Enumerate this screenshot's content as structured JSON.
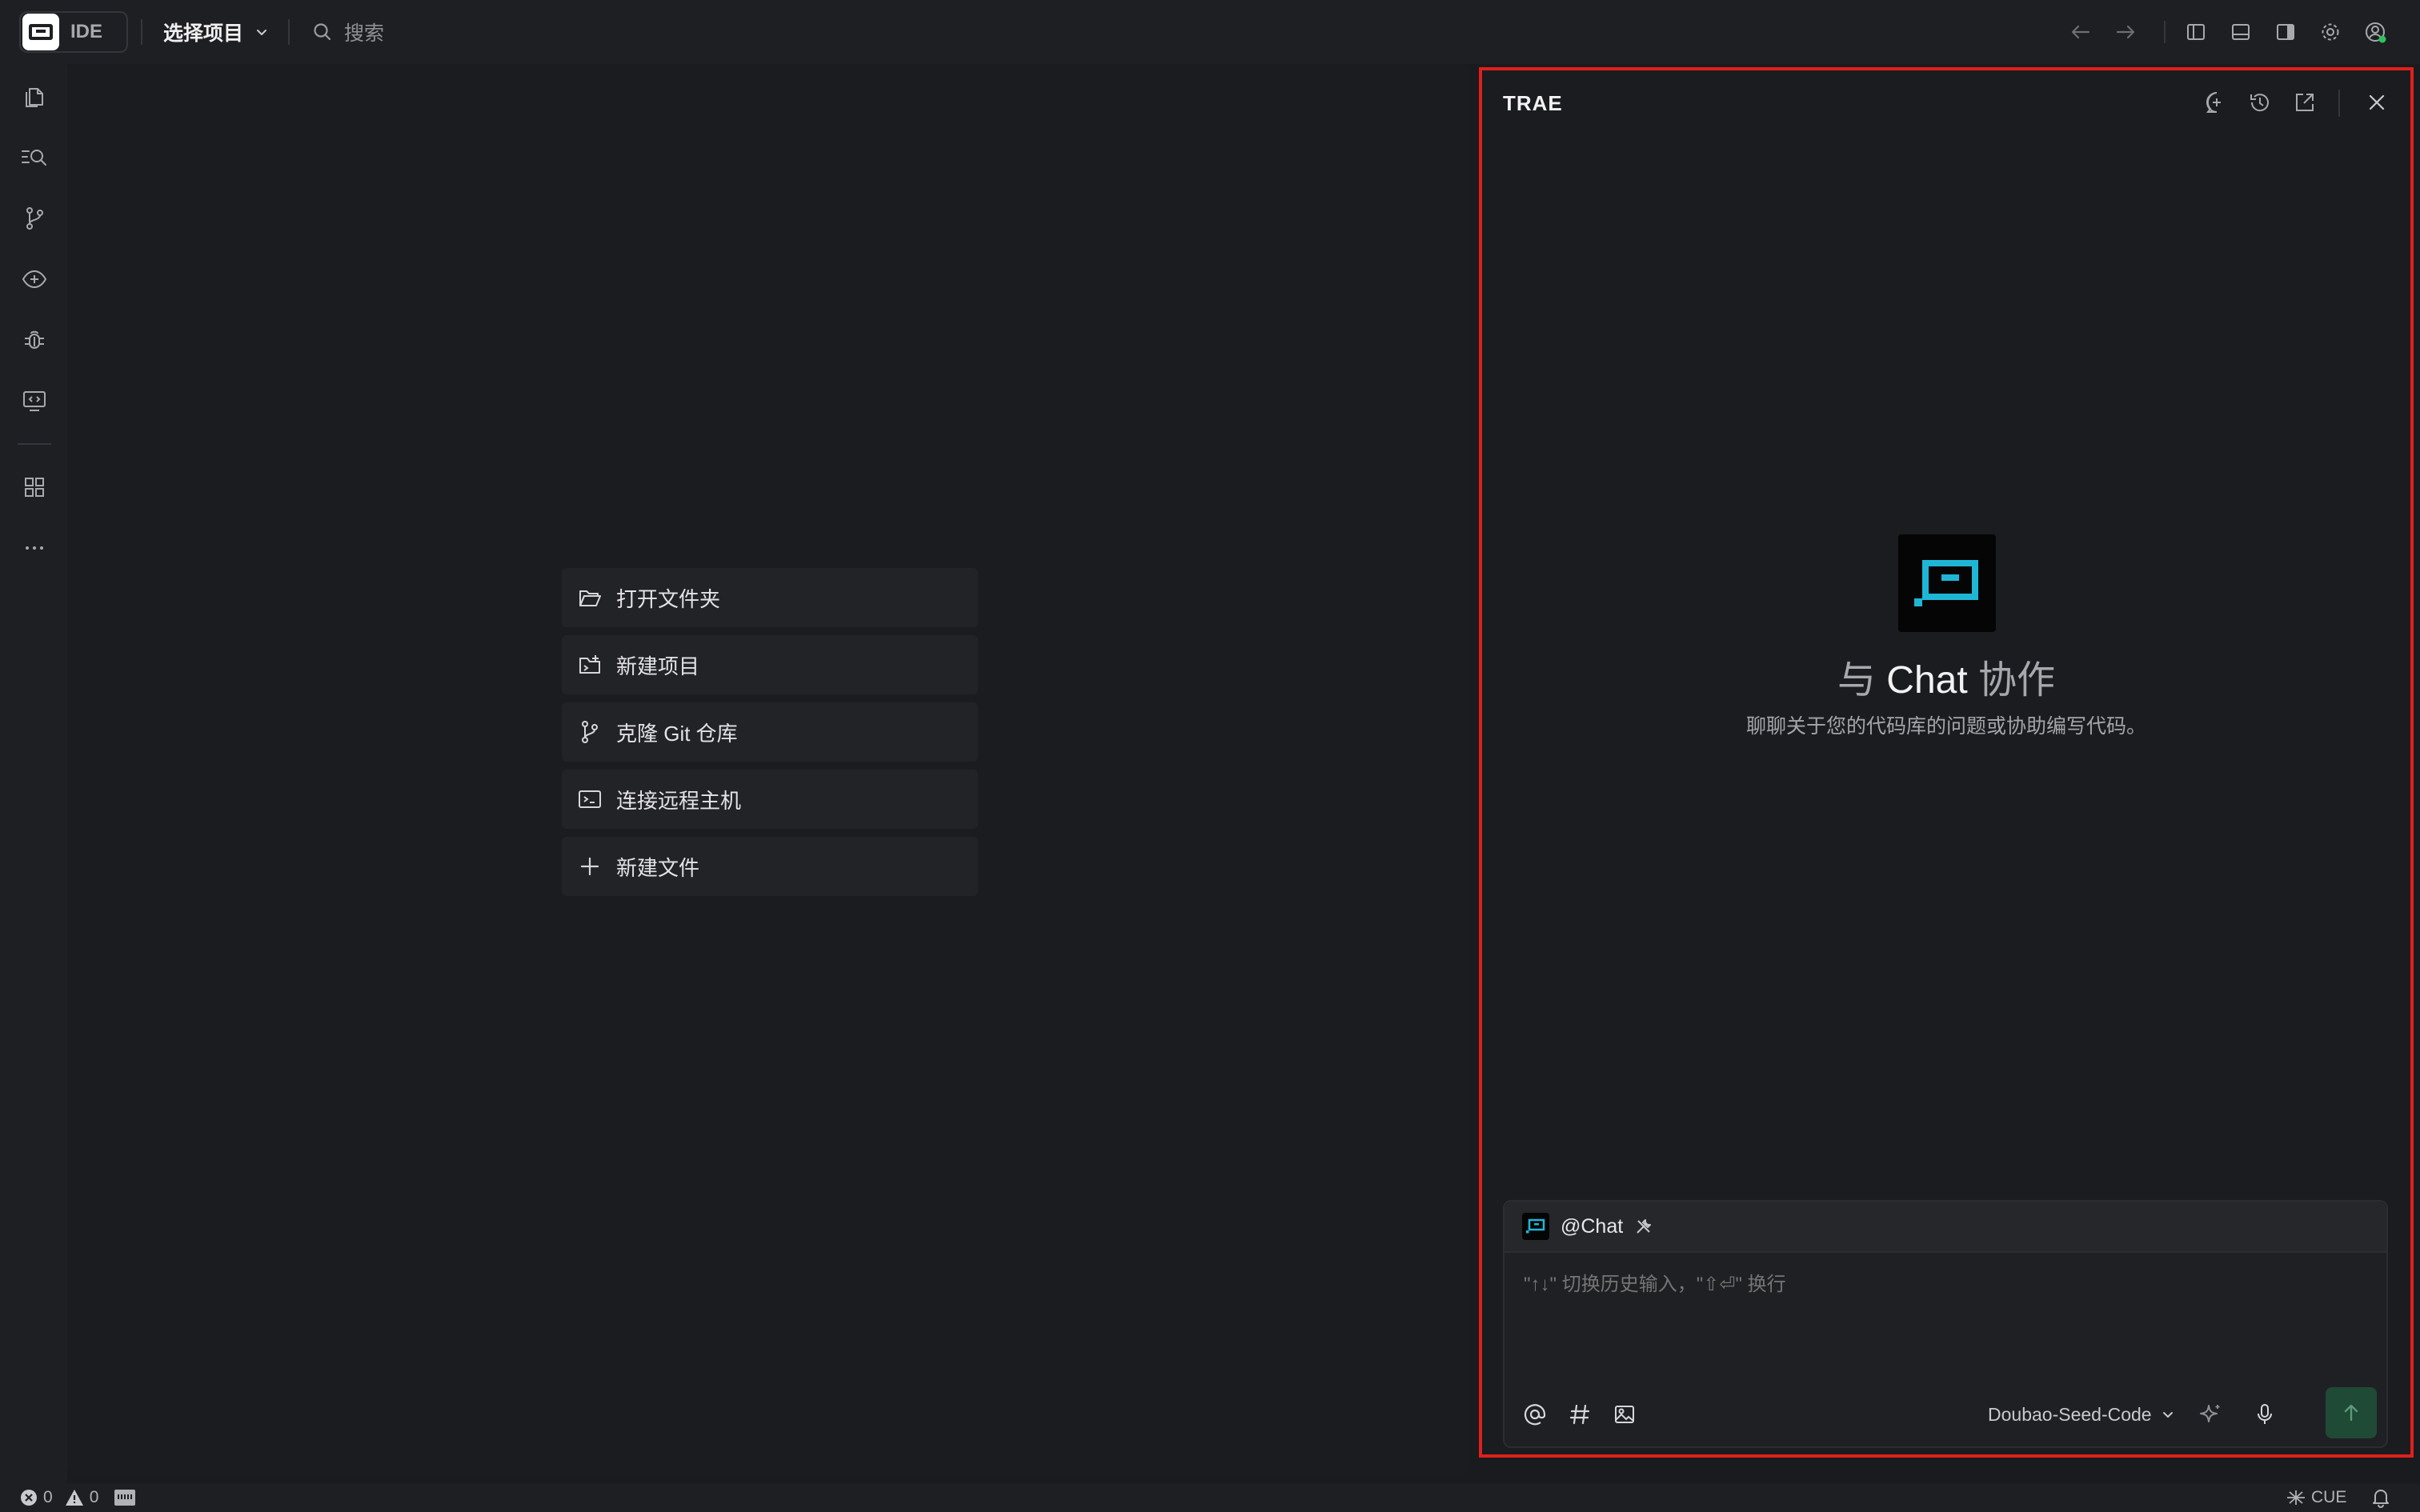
{
  "titlebar": {
    "app_label": "IDE",
    "project_selector": "选择项目",
    "search_placeholder": "搜索"
  },
  "activitybar": {
    "icons": [
      "explorer-icon",
      "search-icon",
      "source-control-icon",
      "preview-icon",
      "debug-icon",
      "remote-icon",
      "extensions-icon",
      "more-icon"
    ]
  },
  "editor": {
    "actions": [
      {
        "label": "打开文件夹",
        "icon": "folder-open-icon"
      },
      {
        "label": "新建项目",
        "icon": "new-project-icon"
      },
      {
        "label": "克隆 Git 仓库",
        "icon": "git-branch-icon"
      },
      {
        "label": "连接远程主机",
        "icon": "terminal-icon"
      },
      {
        "label": "新建文件",
        "icon": "plus-icon"
      }
    ]
  },
  "chat": {
    "panel_title": "TRAE",
    "hero_prefix": "与",
    "hero_name": "Chat",
    "hero_suffix": "协作",
    "hero_subtitle": "聊聊关于您的代码库的问题或协助编写代码。",
    "agent_label": "@Chat",
    "input_placeholder": "\"↑↓\" 切换历史输入，\"⇧⏎\" 换行",
    "model": "Doubao-Seed-Code",
    "accent_color": "#1fb6d6",
    "send_color": "#1f4a35"
  },
  "statusbar": {
    "errors": "0",
    "warnings": "0",
    "language": "CUE"
  },
  "highlight_color": "#e0201c"
}
